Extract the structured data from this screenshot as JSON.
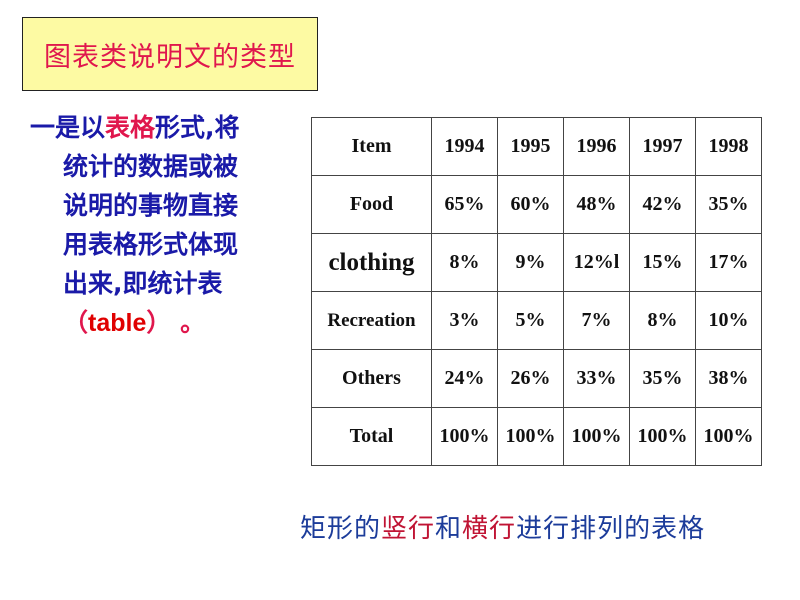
{
  "title": "图表类说明文的类型",
  "paragraph": {
    "line1_pre": "一是以",
    "line1_red": "表格",
    "line1_post": "形式,将",
    "line2": "统计的数据或被",
    "line3": "说明的事物直接",
    "line4": "用表格形式体现",
    "line5": "出来,即统计表",
    "line6_open": "（",
    "line6_word": "table",
    "line6_close": "） 。"
  },
  "table": {
    "headers": [
      "Item",
      "1994",
      "1995",
      "1996",
      "1997",
      "1998"
    ],
    "rows": [
      [
        "Food",
        "65%",
        "60%",
        "48%",
        "42%",
        "35%"
      ],
      [
        "clothing",
        "8%",
        "9%",
        "12%l",
        "15%",
        "17%"
      ],
      [
        "Recreation",
        "3%",
        "5%",
        "7%",
        "8%",
        "10%"
      ],
      [
        "Others",
        "24%",
        "26%",
        "33%",
        "35%",
        "38%"
      ],
      [
        "Total",
        "100%",
        "100%",
        "100%",
        "100%",
        "100%"
      ]
    ]
  },
  "caption": {
    "p1": "矩形的",
    "h1": "竖行",
    "p2": "和",
    "h2": "横行",
    "p3": "进行排列的表格"
  },
  "colors": {
    "title_bg": "#fdfaa3",
    "title_text": "#e0174d",
    "body_text": "#1a1aa8",
    "highlight": "#e0174d",
    "caption_text": "#1c3c9a",
    "caption_highlight": "#c01434"
  }
}
